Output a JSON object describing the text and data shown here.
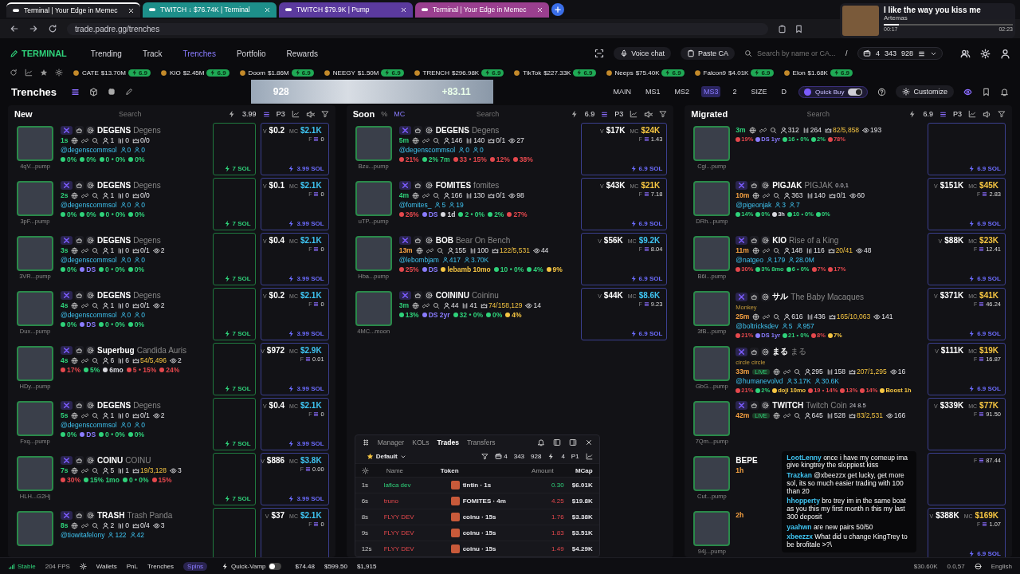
{
  "browser_tabs": [
    {
      "title": "Terminal | Your Edge in Memec",
      "selected": true,
      "color": "#1f1f24"
    },
    {
      "title": "TWITCH ↓ $76.74K | Terminal",
      "selected": false,
      "color": "#1d8f8a"
    },
    {
      "title": "TWITCH $79.9K | Pump",
      "selected": false,
      "color": "#5b3a9e"
    },
    {
      "title": "Terminal | Your Edge in Memec",
      "selected": false,
      "color": "#9a3f8f"
    }
  ],
  "address_bar": {
    "url": "trade.padre.gg/trenches"
  },
  "media": {
    "title": "I like the way you kiss me",
    "artist": "Artemas",
    "elapsed": "00:17",
    "duration": "02:23",
    "level": 0.12
  },
  "nav": {
    "logo": "TERMINAL",
    "items": [
      {
        "label": "Trending",
        "selected": false
      },
      {
        "label": "Track",
        "selected": false
      },
      {
        "label": "Trenches",
        "selected": true
      },
      {
        "label": "Portfolio",
        "selected": false
      },
      {
        "label": "Rewards",
        "selected": false
      }
    ],
    "voice_chat": "Voice chat",
    "paste_ca": "Paste CA",
    "search": {
      "placeholder": "Search by name or CA..."
    },
    "shortcut": "/",
    "wallets": "4",
    "balance_1": "343",
    "balance_2": "928"
  },
  "ticker": [
    {
      "symbol": "CATE",
      "mc": "$13.70M",
      "boost": "6.9"
    },
    {
      "symbol": "KIO",
      "mc": "$2.45M",
      "boost": "6.9"
    },
    {
      "symbol": "Doom",
      "mc": "$1.86M",
      "boost": "6.9"
    },
    {
      "symbol": "NEEGY",
      "mc": "$1.50M",
      "boost": "6.9"
    },
    {
      "symbol": "TRENCH",
      "mc": "$296.98K",
      "boost": "6.9"
    },
    {
      "symbol": "TikTok",
      "mc": "$227.33K",
      "boost": "6.9"
    },
    {
      "symbol": "Neeps",
      "mc": "$75.40K",
      "boost": "6.9"
    },
    {
      "symbol": "Falcon9",
      "mc": "$4.01K",
      "boost": "6.9"
    },
    {
      "symbol": "Elon",
      "mc": "$1.68K",
      "boost": "6.9"
    }
  ],
  "trenches_bar": {
    "title": "Trenches",
    "banner": {
      "count": "928",
      "change": "+83.11"
    },
    "presets": [
      {
        "label": "MAIN",
        "selected": false
      },
      {
        "label": "MS1",
        "selected": false
      },
      {
        "label": "MS2",
        "selected": false
      },
      {
        "label": "MS3",
        "selected": true
      },
      {
        "label": "2",
        "selected": false
      },
      {
        "label": "SIZE",
        "selected": false
      },
      {
        "label": "D",
        "selected": false
      }
    ],
    "quick_buy": {
      "label": "Quick Buy",
      "on": true
    },
    "customize": "Customize"
  },
  "columns": [
    {
      "kind": "new",
      "title": "New",
      "search": {
        "placeholder": "Search"
      },
      "amount": "3.99",
      "preset": "P3",
      "sound": false,
      "cards": [
        {
          "ticker": "DEGENS",
          "name": "Degens",
          "age": {
            "text": "1s",
            "color": "#2fd27a"
          },
          "stats": [
            "1",
            "0",
            "0/0"
          ],
          "handle": "@degenscommsol",
          "handle_stats": [
            "0",
            "0"
          ],
          "metrics": [
            {
              "text": "0%",
              "color": "#2fd27a"
            },
            {
              "text": "0%",
              "color": "#2fd27a"
            },
            {
              "text": "0 • 0%",
              "color": "#2fd27a"
            },
            {
              "text": "0%",
              "color": "#2fd27a"
            }
          ],
          "address": "4qV...pump",
          "quick_buy": "7 SOL",
          "volume": {
            "label": "V",
            "value": "$0.2"
          },
          "market_cap": {
            "label": "MC",
            "value": "$2.1K",
            "color": "#3fc3f0"
          },
          "fee": {
            "label": "F",
            "value": "0"
          },
          "buy": "3.99 SOL"
        },
        {
          "ticker": "DEGENS",
          "name": "Degens",
          "age": {
            "text": "2s",
            "color": "#2fd27a"
          },
          "stats": [
            "1",
            "0",
            "0/0"
          ],
          "handle": "@degenscommsol",
          "handle_stats": [
            "0",
            "0"
          ],
          "metrics": [
            {
              "text": "0%",
              "color": "#2fd27a"
            },
            {
              "text": "0%",
              "color": "#2fd27a"
            },
            {
              "text": "0 • 0%",
              "color": "#2fd27a"
            },
            {
              "text": "0%",
              "color": "#2fd27a"
            }
          ],
          "address": "3pF...pump",
          "quick_buy": "7 SOL",
          "volume": {
            "label": "V",
            "value": "$0.1"
          },
          "market_cap": {
            "label": "MC",
            "value": "$2.1K",
            "color": "#3fc3f0"
          },
          "fee": {
            "label": "F",
            "value": "0"
          },
          "buy": "3.99 SOL"
        },
        {
          "ticker": "DEGENS",
          "name": "Degens",
          "age": {
            "text": "3s",
            "color": "#2fd27a"
          },
          "stats": [
            "1",
            "0",
            "0/1"
          ],
          "views": "2",
          "handle": "@degenscommsol",
          "handle_stats": [
            "0",
            "0"
          ],
          "metrics": [
            {
              "text": "0%",
              "color": "#2fd27a"
            },
            {
              "text": "DS",
              "color": "#8a7cff"
            },
            {
              "text": "0 • 0%",
              "color": "#2fd27a"
            },
            {
              "text": "0%",
              "color": "#2fd27a"
            }
          ],
          "address": "3VR...pump",
          "quick_buy": "7 SOL",
          "volume": {
            "label": "V",
            "value": "$0.4"
          },
          "market_cap": {
            "label": "MC",
            "value": "$2.1K",
            "color": "#3fc3f0"
          },
          "fee": {
            "label": "F",
            "value": "0"
          },
          "buy": "3.99 SOL"
        },
        {
          "ticker": "DEGENS",
          "name": "Degens",
          "age": {
            "text": "4s",
            "color": "#2fd27a"
          },
          "stats": [
            "1",
            "0",
            "0/1"
          ],
          "views": "2",
          "handle": "@degenscommsol",
          "handle_stats": [
            "0",
            "0"
          ],
          "metrics": [
            {
              "text": "0%",
              "color": "#2fd27a"
            },
            {
              "text": "DS",
              "color": "#8a7cff"
            },
            {
              "text": "0 • 0%",
              "color": "#2fd27a"
            },
            {
              "text": "0%",
              "color": "#2fd27a"
            }
          ],
          "address": "Dux...pump",
          "quick_buy": "7 SOL",
          "volume": {
            "label": "V",
            "value": "$0.2"
          },
          "market_cap": {
            "label": "MC",
            "value": "$2.1K",
            "color": "#3fc3f0"
          },
          "fee": {
            "label": "F",
            "value": "0"
          },
          "buy": "3.99 SOL"
        },
        {
          "ticker": "Superbug",
          "name": "Candida Auris",
          "age": {
            "text": "4s",
            "color": "#2fd27a"
          },
          "stats": [
            "6",
            "6",
            "54/5,496"
          ],
          "views": "2",
          "metrics": [
            {
              "text": "17%",
              "color": "#e5484d"
            },
            {
              "text": "5%",
              "color": "#2fd27a"
            },
            {
              "text": "6mo",
              "color": "#d8d8de"
            },
            {
              "text": "5 • 15%",
              "color": "#e5484d"
            },
            {
              "text": "24%",
              "color": "#e5484d"
            }
          ],
          "address": "HDy...pump",
          "quick_buy": "7 SOL",
          "volume": {
            "label": "V",
            "value": "$972"
          },
          "market_cap": {
            "label": "MC",
            "value": "$2.9K",
            "color": "#3fc3f0"
          },
          "fee": {
            "label": "F",
            "value": "0.01"
          },
          "buy": "3.99 SOL"
        },
        {
          "ticker": "DEGENS",
          "name": "Degens",
          "age": {
            "text": "5s",
            "color": "#2fd27a"
          },
          "stats": [
            "1",
            "0",
            "0/1"
          ],
          "views": "2",
          "handle": "@degenscommsol",
          "handle_stats": [
            "0",
            "0"
          ],
          "metrics": [
            {
              "text": "0%",
              "color": "#2fd27a"
            },
            {
              "text": "DS",
              "color": "#8a7cff"
            },
            {
              "text": "0 • 0%",
              "color": "#2fd27a"
            },
            {
              "text": "0%",
              "color": "#2fd27a"
            }
          ],
          "address": "Fxq...pump",
          "quick_buy": "7 SOL",
          "volume": {
            "label": "V",
            "value": "$0.4"
          },
          "market_cap": {
            "label": "MC",
            "value": "$2.1K",
            "color": "#3fc3f0"
          },
          "fee": {
            "label": "F",
            "value": "0"
          },
          "buy": "3.99 SOL"
        },
        {
          "ticker": "COINU",
          "name": "COINU",
          "age": {
            "text": "7s",
            "color": "#2fd27a"
          },
          "stats": [
            "5",
            "1",
            "19/3,128"
          ],
          "views": "3",
          "metrics": [
            {
              "text": "30%",
              "color": "#e5484d"
            },
            {
              "text": "15% 1mo",
              "color": "#2fd27a"
            },
            {
              "text": "0 • 0%",
              "color": "#2fd27a"
            },
            {
              "text": "15%",
              "color": "#e5484d"
            }
          ],
          "address": "HLH...G2Hj",
          "quick_buy": "7 SOL",
          "volume": {
            "label": "V",
            "value": "$886"
          },
          "market_cap": {
            "label": "MC",
            "value": "$3.8K",
            "color": "#3fc3f0"
          },
          "fee": {
            "label": "F",
            "value": "0.00"
          },
          "buy": "3.99 SOL"
        },
        {
          "ticker": "TRASH",
          "name": "Trash Panda",
          "age": {
            "text": "8s",
            "color": "#2fd27a"
          },
          "stats": [
            "2",
            "0",
            "0/4"
          ],
          "views": "3",
          "handle": "@tiowitafelony",
          "handle_stats": [
            "122",
            "42"
          ],
          "volume": {
            "label": "V",
            "value": "$37"
          },
          "market_cap": {
            "label": "MC",
            "value": "$2.1K",
            "color": "#3fc3f0"
          },
          "fee": {
            "label": "F",
            "value": "0"
          }
        }
      ]
    },
    {
      "kind": "soon",
      "title": "Soon",
      "toggles": [
        {
          "label": "%",
          "selected": false
        },
        {
          "label": "MC",
          "selected": true
        }
      ],
      "search": {
        "placeholder": "Search"
      },
      "amount": "6.9",
      "preset": "P3",
      "sound": false,
      "cards": [
        {
          "ticker": "DEGENS",
          "name": "Degens",
          "age": {
            "text": "5m",
            "color": "#2fd27a"
          },
          "stats": [
            "146",
            "140",
            "0/1"
          ],
          "views": "27",
          "handle": "@degenscommsol",
          "handle_stats": [
            "0",
            "0"
          ],
          "metrics": [
            {
              "text": "21%",
              "color": "#e5484d"
            },
            {
              "text": "2% 7m",
              "color": "#2fd27a"
            },
            {
              "text": "33 • 15%",
              "color": "#e5484d"
            },
            {
              "text": "12%",
              "color": "#e5484d"
            },
            {
              "text": "38%",
              "color": "#e5484d"
            }
          ],
          "address": "Bzu...pump",
          "volume": {
            "label": "V",
            "value": "$17K"
          },
          "market_cap": {
            "label": "MC",
            "value": "$24K",
            "color": "#f5c542"
          },
          "fee": {
            "label": "F",
            "value": "1.43"
          },
          "buy": "6.9 SOL"
        },
        {
          "ticker": "FOMITES",
          "name": "fomites",
          "age": {
            "text": "4m",
            "color": "#2fd27a"
          },
          "stats": [
            "166",
            "130",
            "0/1"
          ],
          "views": "98",
          "handle": "@fomites_",
          "handle_stats": [
            "5",
            "19"
          ],
          "metrics": [
            {
              "text": "26%",
              "color": "#e5484d"
            },
            {
              "text": "DS",
              "color": "#8a7cff"
            },
            {
              "text": "1d",
              "color": "#d8d8de"
            },
            {
              "text": "2 • 0%",
              "color": "#2fd27a"
            },
            {
              "text": "2%",
              "color": "#2fd27a"
            },
            {
              "text": "27%",
              "color": "#e5484d"
            }
          ],
          "address": "uTP...pump",
          "volume": {
            "label": "V",
            "value": "$43K"
          },
          "market_cap": {
            "label": "MC",
            "value": "$21K",
            "color": "#f5c542"
          },
          "fee": {
            "label": "F",
            "value": "7.18"
          },
          "buy": "6.9 SOL"
        },
        {
          "ticker": "BOB",
          "name": "Bear On Bench",
          "age": {
            "text": "13m",
            "color": "#f5a142"
          },
          "stats": [
            "155",
            "100",
            "122/5,531"
          ],
          "views": "44",
          "handle": "@lebombjam",
          "handle_stats": [
            "417",
            "3.70K"
          ],
          "metrics": [
            {
              "text": "25%",
              "color": "#e5484d"
            },
            {
              "text": "DS",
              "color": "#8a7cff"
            },
            {
              "text": "lebamb 10mo",
              "color": "#f5c542"
            },
            {
              "text": "10 • 0%",
              "color": "#2fd27a"
            },
            {
              "text": "4%",
              "color": "#2fd27a"
            },
            {
              "text": "9%",
              "color": "#f5c542"
            }
          ],
          "address": "Hba...pump",
          "volume": {
            "label": "V",
            "value": "$56K"
          },
          "market_cap": {
            "label": "MC",
            "value": "$9.2K",
            "color": "#3fc3f0"
          },
          "fee": {
            "label": "F",
            "value": "8.04"
          },
          "buy": "6.9 SOL"
        },
        {
          "ticker": "COININU",
          "name": "Coininu",
          "age": {
            "text": "3m",
            "color": "#2fd27a"
          },
          "stats": [
            "44",
            "41",
            "74/158,129"
          ],
          "views": "14",
          "metrics": [
            {
              "text": "13%",
              "color": "#2fd27a"
            },
            {
              "text": "DS 2yr",
              "color": "#8a7cff"
            },
            {
              "text": "32 • 0%",
              "color": "#2fd27a"
            },
            {
              "text": "0%",
              "color": "#2fd27a"
            },
            {
              "text": "4%",
              "color": "#f5c542"
            }
          ],
          "address": "4MC...moon",
          "volume": {
            "label": "V",
            "value": "$44K"
          },
          "market_cap": {
            "label": "MC",
            "value": "$8.6K",
            "color": "#3fc3f0"
          },
          "fee": {
            "label": "F",
            "value": "9.23"
          },
          "buy": "6.9 SOL"
        }
      ],
      "trades_panel": {
        "tabs": [
          {
            "label": "Manager",
            "selected": false
          },
          {
            "label": "KOLs",
            "selected": false
          },
          {
            "label": "Trades",
            "selected": true
          },
          {
            "label": "Transfers",
            "selected": false
          }
        ],
        "preset": "Default",
        "wallets": "4",
        "balance_1": "343",
        "balance_2": "928",
        "amount": "4",
        "page": "P1",
        "columns": [
          "Name",
          "Token",
          "Amount",
          "MCap"
        ],
        "rows": [
          {
            "time": "1s",
            "name": "lafica dev",
            "token": "tintin · 1s",
            "amount": "0.30",
            "mcap": "$6.01K",
            "buy": true
          },
          {
            "time": "6s",
            "name": "truno",
            "token": "FOMITES · 4m",
            "amount": "4.25",
            "mcap": "$19.8K",
            "buy": false
          },
          {
            "time": "8s",
            "name": "FLYY DEV",
            "token": "coinu · 15s",
            "amount": "1.76",
            "mcap": "$3.38K",
            "buy": false
          },
          {
            "time": "9s",
            "name": "FLYY DEV",
            "token": "coinu · 15s",
            "amount": "1.83",
            "mcap": "$3.51K",
            "buy": false
          },
          {
            "time": "12s",
            "name": "FLYY DEV",
            "token": "coinu · 15s",
            "amount": "1.49",
            "mcap": "$4.29K",
            "buy": false
          }
        ]
      }
    },
    {
      "kind": "migrated",
      "title": "Migrated",
      "search": {
        "placeholder": "Search"
      },
      "amount": "6.9",
      "preset": "P3",
      "sound": true,
      "cards": [
        {
          "age": {
            "text": "3m",
            "color": "#2fd27a"
          },
          "stats": [
            "312",
            "264",
            "82/5,858"
          ],
          "views": "193",
          "metrics": [
            {
              "text": "19%",
              "color": "#e5484d"
            },
            {
              "text": "DS 1yr",
              "color": "#8a7cff"
            },
            {
              "text": "16 • 0%",
              "color": "#2fd27a"
            },
            {
              "text": "2%",
              "color": "#2fd27a"
            },
            {
              "text": "78%",
              "color": "#e5484d"
            }
          ],
          "address": "Cgi...pump",
          "buy": "6.9 SOL"
        },
        {
          "ticker": "PIGJAK",
          "name": "PIGJAK",
          "extra": "0.0,1",
          "age": {
            "text": "10m",
            "color": "#f5a142"
          },
          "stats": [
            "363",
            "140",
            "0/1"
          ],
          "views": "60",
          "handle": "@pigeonjak",
          "handle_stats": [
            "3",
            "7"
          ],
          "metrics": [
            {
              "text": "14%",
              "color": "#2fd27a"
            },
            {
              "text": "0%",
              "color": "#2fd27a"
            },
            {
              "text": "3h",
              "color": "#d8d8de"
            },
            {
              "text": "10 • 0%",
              "color": "#2fd27a"
            },
            {
              "text": "0%",
              "color": "#2fd27a"
            }
          ],
          "address": "DRh...pump",
          "volume": {
            "label": "V",
            "value": "$151K"
          },
          "market_cap": {
            "label": "MC",
            "value": "$45K",
            "color": "#f5c542"
          },
          "fee": {
            "label": "F",
            "value": "2.83"
          },
          "buy": "6.9 SOL"
        },
        {
          "ticker": "KIO",
          "name": "Rise of a King",
          "age": {
            "text": "11m",
            "color": "#f5a142"
          },
          "stats": [
            "148",
            "116",
            "20/41"
          ],
          "views": "48",
          "handle": "@natgeo",
          "handle_stats": [
            "179",
            "28.0M"
          ],
          "metrics": [
            {
              "text": "30%",
              "color": "#e5484d"
            },
            {
              "text": "3% 8mo",
              "color": "#2fd27a"
            },
            {
              "text": "6 • 0%",
              "color": "#2fd27a"
            },
            {
              "text": "7%",
              "color": "#e5484d"
            },
            {
              "text": "17%",
              "color": "#e5484d"
            }
          ],
          "address": "B6i...pump",
          "volume": {
            "label": "V",
            "value": "$88K"
          },
          "market_cap": {
            "label": "MC",
            "value": "$23K",
            "color": "#f5c542"
          },
          "fee": {
            "label": "F",
            "value": "12.41"
          },
          "buy": "6.9 SOL"
        },
        {
          "ticker": "サル",
          "name": "The Baby Macaques",
          "sub": "Monkey",
          "age": {
            "text": "25m",
            "color": "#f5a142"
          },
          "stats": [
            "616",
            "436",
            "165/10,063"
          ],
          "views": "141",
          "handle": "@boltricksdev",
          "handle_stats": [
            "5",
            "957"
          ],
          "metrics": [
            {
              "text": "21%",
              "color": "#e5484d"
            },
            {
              "text": "DS 1yr",
              "color": "#8a7cff"
            },
            {
              "text": "21 • 0%",
              "color": "#2fd27a"
            },
            {
              "text": "8%",
              "color": "#e5484d"
            },
            {
              "text": "7%",
              "color": "#f5c542"
            }
          ],
          "address": "3fB...pump",
          "volume": {
            "label": "V",
            "value": "$371K"
          },
          "market_cap": {
            "label": "MC",
            "value": "$41K",
            "color": "#f5c542"
          },
          "fee": {
            "label": "F",
            "value": "46.24"
          },
          "buy": "6.9 SOL"
        },
        {
          "ticker": "まる",
          "name": "まる",
          "sub": "circle circle",
          "age": {
            "text": "33m",
            "color": "#f5a142"
          },
          "live": "LIVE",
          "stats": [
            "295",
            "158",
            "207/1,295"
          ],
          "views": "16",
          "handle": "@humanevolvd",
          "handle_stats": [
            "3.17K",
            "30.6K"
          ],
          "metrics": [
            {
              "text": "21%",
              "color": "#e5484d"
            },
            {
              "text": "2%",
              "color": "#2fd27a"
            },
            {
              "text": "doji 10mo",
              "color": "#f5c542"
            },
            {
              "text": "19 • 14%",
              "color": "#e5484d"
            },
            {
              "text": "13%",
              "color": "#e5484d"
            },
            {
              "text": "14%",
              "color": "#e5484d"
            },
            {
              "text": "Boost 1h",
              "color": "#f5c542"
            }
          ],
          "address": "GbG...pump",
          "volume": {
            "label": "V",
            "value": "$111K"
          },
          "market_cap": {
            "label": "MC",
            "value": "$19K",
            "color": "#f5c542"
          },
          "fee": {
            "label": "F",
            "value": "16.87"
          },
          "buy": "6.9 SOL"
        },
        {
          "ticker": "TWITCH",
          "name": "Twitch Coin",
          "extra": "24 8.5",
          "age": {
            "text": "42m",
            "color": "#f5a142"
          },
          "live": "LIVE",
          "stats": [
            "645",
            "528",
            "83/2,531"
          ],
          "views": "166",
          "address": "7Qm...pump",
          "volume": {
            "label": "V",
            "value": "$339K"
          },
          "market_cap": {
            "label": "MC",
            "value": "$77K",
            "color": "#f5c542"
          },
          "fee": {
            "label": "F",
            "value": "91.50"
          }
        },
        {
          "ticker": "BEPE",
          "age": {
            "text": "1h",
            "color": "#f5a142"
          },
          "address": "Cut...pump",
          "fee": {
            "label": "F",
            "value": "87.44"
          }
        },
        {
          "age": {
            "text": "2h",
            "color": "#f5a142"
          },
          "address": "94j...pump",
          "volume": {
            "label": "V",
            "value": "$388K"
          },
          "market_cap": {
            "label": "MC",
            "value": "$169K",
            "color": "#f5c542"
          },
          "fee": {
            "label": "F",
            "value": "1.07"
          },
          "buy": "6.9 SOL"
        }
      ],
      "chat": [
        {
          "user": "LootLenny",
          "text": "once i have my comeup ima give kingtrey the sloppiest kiss"
        },
        {
          "user": "Trazkan",
          "text": "@xbeezzx get lucky, get more sol, its so much easier trading with 100 than 20"
        },
        {
          "user": "hhopperty",
          "text": "bro trey im in the same boat as you this my first month n this my last 300 deposit"
        },
        {
          "user": "yaahwn",
          "text": "are new pairs 50/50"
        },
        {
          "user": "xbeezzx",
          "text": "What did u change KingTrey to be brofitale >?\\"
        }
      ]
    }
  ],
  "status_bar": {
    "connection": "Stable",
    "fps": "204 FPS",
    "links": [
      "Wallets",
      "PnL",
      "Trenches"
    ],
    "spins": "Spins",
    "quick_vamp": {
      "label": "Quick-Vamp",
      "on": false
    },
    "balances": [
      "$74.48",
      "$599.50",
      "$1,915"
    ],
    "stats": [
      "$30.60K",
      "0.0,57"
    ],
    "language": "English"
  }
}
